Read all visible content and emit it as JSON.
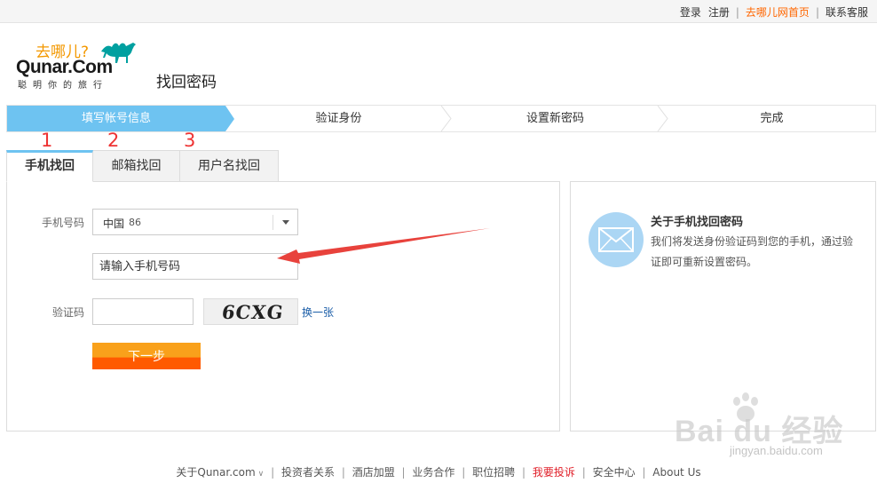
{
  "topbar": {
    "login": "登录",
    "register": "注册",
    "home": "去哪儿网首页",
    "service": "联系客服",
    "separator": "|"
  },
  "header": {
    "logo_cn": "去哪儿?",
    "logo_en": "Qunar.Com",
    "logo_slogan": "聪明你的旅行",
    "page_title": "找回密码"
  },
  "steps": [
    {
      "label": "填写帐号信息",
      "state": "active"
    },
    {
      "label": "验证身份",
      "state": "pending"
    },
    {
      "label": "设置新密码",
      "state": "pending"
    },
    {
      "label": "完成",
      "state": "pending"
    }
  ],
  "annotations": [
    "1",
    "2",
    "3"
  ],
  "tabs": [
    {
      "label": "手机找回",
      "active": true
    },
    {
      "label": "邮箱找回",
      "active": false
    },
    {
      "label": "用户名找回",
      "active": false
    }
  ],
  "form": {
    "phone_label": "手机号码",
    "country": "中国",
    "country_code": "86",
    "phone_placeholder": "请输入手机号码",
    "captcha_label": "验证码",
    "captcha_value": "",
    "captcha_text": "6CXG",
    "refresh_label": "换一张",
    "next_label": "下一步"
  },
  "side": {
    "title": "关于手机找回密码",
    "text": "我们将发送身份验证码到您的手机，通过验证即可重新设置密码。"
  },
  "footer": {
    "links": [
      "关于Qunar.com",
      "投资者关系",
      "酒店加盟",
      "业务合作",
      "职位招聘",
      "我要投诉",
      "安全中心",
      "About Us"
    ],
    "separator": "|"
  },
  "watermark": {
    "text": "Bai du 经验",
    "url": "jingyan.baidu.com"
  },
  "colors": {
    "accent_blue": "#6ec3f1",
    "orange": "#ff6600",
    "button_top": "#f9a11b",
    "button_bottom": "#ff5a00",
    "annotation_red": "#e33333",
    "link_blue": "#1b5ea8"
  }
}
